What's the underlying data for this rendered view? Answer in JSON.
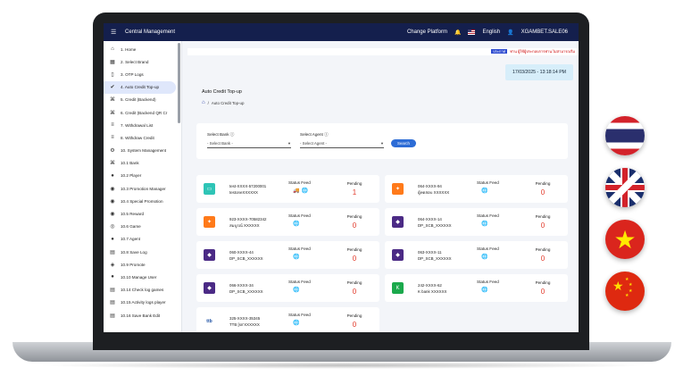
{
  "app": {
    "title": "Central Management"
  },
  "topbar": {
    "platform_label": "Change Platform",
    "language": "English",
    "user": "XGAMBET.SALE06"
  },
  "sidebar": {
    "items": [
      {
        "label": "1. Home",
        "icon": "home-icon"
      },
      {
        "label": "2. Select Brand",
        "icon": "calendar-icon"
      },
      {
        "label": "3. OTP Logs",
        "icon": "phone-icon"
      },
      {
        "label": "4. Auto Credit Top-up",
        "icon": "check-circle-icon"
      },
      {
        "label": "5. Credit (Backend)",
        "icon": "bank-icon"
      },
      {
        "label": "6. Credit (Backend QR Cr",
        "icon": "bank-icon"
      },
      {
        "label": "7. Withdrawal List",
        "icon": "list-icon"
      },
      {
        "label": "8. Withdraw Credit",
        "icon": "list-icon"
      },
      {
        "label": "10. System Management",
        "icon": "gear-icon"
      },
      {
        "label": "10.1 Bank",
        "icon": "bank-icon"
      },
      {
        "label": "10.2 Player",
        "icon": "user-icon"
      },
      {
        "label": "10.3 Promotion Manager",
        "icon": "gift-icon"
      },
      {
        "label": "10.4 Special Promotion",
        "icon": "gift-icon"
      },
      {
        "label": "10.5 Reward",
        "icon": "gift-icon"
      },
      {
        "label": "10.6 Game",
        "icon": "gamepad-icon"
      },
      {
        "label": "10.7 Agent",
        "icon": "user-icon"
      },
      {
        "label": "10.8 Save Log",
        "icon": "doc-icon"
      },
      {
        "label": "10.9 Promote",
        "icon": "megaphone-icon"
      },
      {
        "label": "10.10 Manage User",
        "icon": "user-icon"
      },
      {
        "label": "10.14 Check log games",
        "icon": "doc-icon"
      },
      {
        "label": "10.15 Activity logs player",
        "icon": "doc-icon"
      },
      {
        "label": "10.16 Save Bank Edit",
        "icon": "doc-icon"
      }
    ]
  },
  "marquee": {
    "tag": "ประกาศ",
    "text": "ท่าน ผู้ใช้ผู้ประกอบการท่าน ไม่สามารถเริ่ม"
  },
  "datetime": "17/03/2025 - 13:18:14 PM",
  "page": {
    "title": "Auto Credit Top-up",
    "breadcrumb": "Auto Credit Top-up"
  },
  "filter": {
    "bank_label": "Select Bank",
    "bank_placeholder": "- Select Bank -",
    "agent_label": "Select Agent",
    "agent_placeholder": "- Select Agent -",
    "search_label": "Search"
  },
  "cards": [
    {
      "acct": "test-XXXX-57200001",
      "name": "testoneXXXXXX",
      "status": "Status Feed",
      "pending_label": "Pending",
      "pending": "1",
      "logo_color": "#2ec4b6",
      "logo": "▭"
    },
    {
      "acct": "064-XXXX-94",
      "name": "ผู้ทดสอบ XXXXXX",
      "status": "Status Feed",
      "pending_label": "Pending",
      "pending": "0",
      "logo_color": "#ff7a1a",
      "logo": "✦"
    },
    {
      "acct": "923-XXXX-70582342",
      "name": "สมบูรณ์ XXXXXX",
      "status": "Status Feed",
      "pending_label": "Pending",
      "pending": "0",
      "logo_color": "#ff7a1a",
      "logo": "✦"
    },
    {
      "acct": "064-XXXX-14",
      "name": "DP_SCB_XXXXXX",
      "status": "Status Feed",
      "pending_label": "Pending",
      "pending": "0",
      "logo_color": "#4b2a85",
      "logo": "◆"
    },
    {
      "acct": "060-XXXX-44",
      "name": "DP_SCB_XXXXXX",
      "status": "Status Feed",
      "pending_label": "Pending",
      "pending": "0",
      "logo_color": "#4b2a85",
      "logo": "◆"
    },
    {
      "acct": "063-XXXX-11",
      "name": "DP_SCB_XXXXXX",
      "status": "Status Feed",
      "pending_label": "Pending",
      "pending": "0",
      "logo_color": "#4b2a85",
      "logo": "◆"
    },
    {
      "acct": "066-XXXX-34",
      "name": "DP_SCB_XXXXXX",
      "status": "Status Feed",
      "pending_label": "Pending",
      "pending": "0",
      "logo_color": "#4b2a85",
      "logo": "◆"
    },
    {
      "acct": "242-XXXX-62",
      "name": "K bank XXXXXX",
      "status": "Status Feed",
      "pending_label": "Pending",
      "pending": "0",
      "logo_color": "#1ba94c",
      "logo": "K"
    },
    {
      "acct": "325-XXXX-35345",
      "name": "TTB [sn'XXXXXX",
      "status": "Status Feed",
      "pending_label": "Pending",
      "pending": "0",
      "logo_color": "#ffffff",
      "logo": "ttb"
    }
  ]
}
